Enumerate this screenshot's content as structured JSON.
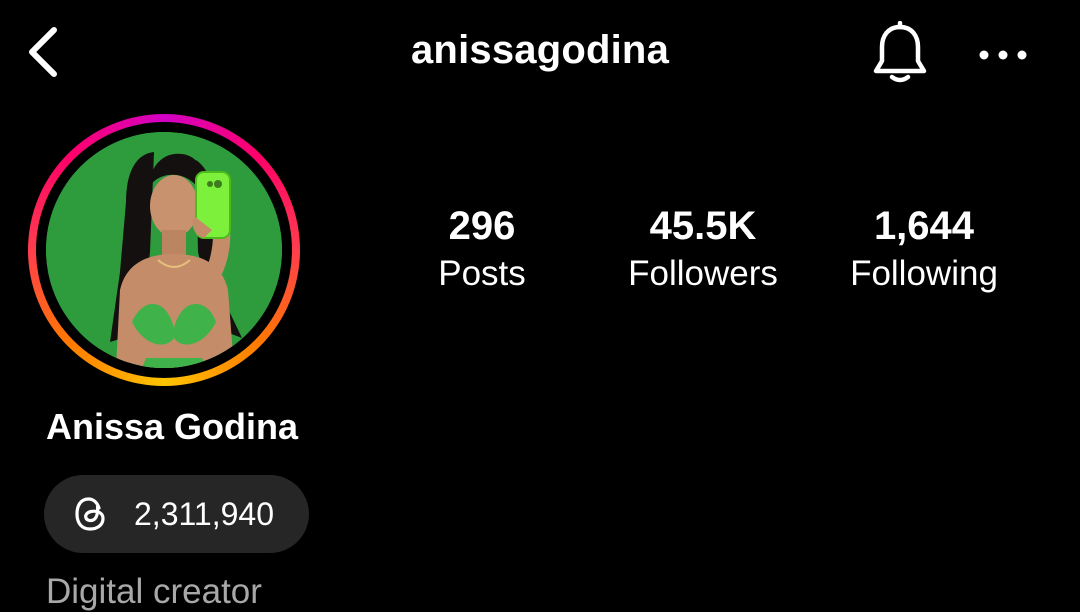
{
  "header": {
    "username": "anissagodina",
    "back_icon": "chevron-left-icon",
    "bell_icon": "bell-icon",
    "more_icon": "more-horizontal-icon"
  },
  "profile": {
    "avatar_icon": "profile-photo",
    "full_name": "Anissa Godina",
    "category": "Digital creator"
  },
  "stats": [
    {
      "value": "296",
      "label": "Posts"
    },
    {
      "value": "45.5K",
      "label": "Followers"
    },
    {
      "value": "1,644",
      "label": "Following"
    }
  ],
  "threads": {
    "icon": "threads-icon",
    "count": "2,311,940"
  },
  "colors": {
    "background": "#000000",
    "text": "#ffffff",
    "muted_text": "#a8a8a8",
    "pill_bg": "#262626",
    "story_ring_start": "#ffc500",
    "story_ring_end": "#d300c5"
  }
}
